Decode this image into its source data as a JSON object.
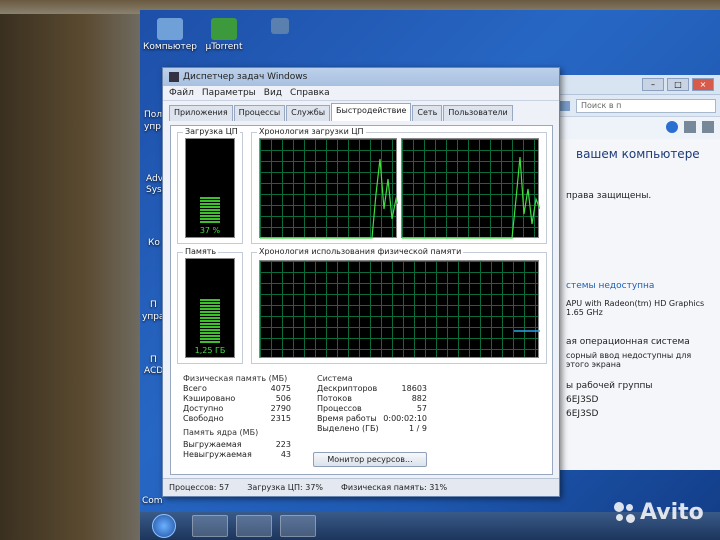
{
  "desktop": {
    "icons": [
      {
        "label": "Компьютер",
        "color": "#6fa0d8"
      },
      {
        "label": "µTorrent",
        "color": "#3c9a3c"
      },
      {
        "label": "",
        "color": "#5a80b0"
      }
    ],
    "side_labels": [
      "Пол",
      "упр - С",
      "Adv",
      "Syst",
      "Ко",
      "П",
      "упра",
      "П",
      "ACD",
      "Com"
    ]
  },
  "explorer": {
    "search_placeholder": "Поиск в п",
    "heading": "вашем компьютере",
    "rights": "права защищены.",
    "link": "стемы недоступна",
    "cpu": "APU with Radeon(tm) HD Graphics  1.65 GHz",
    "os": "ая операционная система",
    "pen": "сорный ввод недоступны для этого экрана",
    "workgroup": "ы рабочей группы",
    "comp1": "6EJ3SD",
    "comp2": "6EJ3SD"
  },
  "taskmanager": {
    "title": "Диспетчер задач Windows",
    "menu": [
      "Файл",
      "Параметры",
      "Вид",
      "Справка"
    ],
    "tabs": [
      "Приложения",
      "Процессы",
      "Службы",
      "Быстродействие",
      "Сеть",
      "Пользователи"
    ],
    "active_tab": 3,
    "cpu_group": "Загрузка ЦП",
    "cpu_value": "37 %",
    "cpu_level": 0.37,
    "cpu_history_group": "Хронология загрузки ЦП",
    "mem_group": "Память",
    "mem_value": "1,25 ГБ",
    "mem_level": 0.31,
    "mem_history_group": "Хронология использования физической памяти",
    "phys_title": "Физическая память (МБ)",
    "phys": [
      {
        "label": "Всего",
        "value": "4075"
      },
      {
        "label": "Кэшировано",
        "value": "506"
      },
      {
        "label": "Доступно",
        "value": "2790"
      },
      {
        "label": "Свободно",
        "value": "2315"
      }
    ],
    "kernel_title": "Память ядра (МБ)",
    "kernel": [
      {
        "label": "Выгружаемая",
        "value": "223"
      },
      {
        "label": "Невыгружаемая",
        "value": "43"
      }
    ],
    "system_title": "Система",
    "system": [
      {
        "label": "Дескрипторов",
        "value": "18603"
      },
      {
        "label": "Потоков",
        "value": "882"
      },
      {
        "label": "Процессов",
        "value": "57"
      },
      {
        "label": "Время работы",
        "value": "0:00:02:10"
      },
      {
        "label": "Выделено (ГБ)",
        "value": "1 / 9"
      }
    ],
    "monitor_button": "Монитор ресурсов...",
    "status": {
      "processes": "Процессов: 57",
      "cpu": "Загрузка ЦП: 37%",
      "memory": "Физическая память: 31%"
    }
  },
  "watermark": "Avito"
}
